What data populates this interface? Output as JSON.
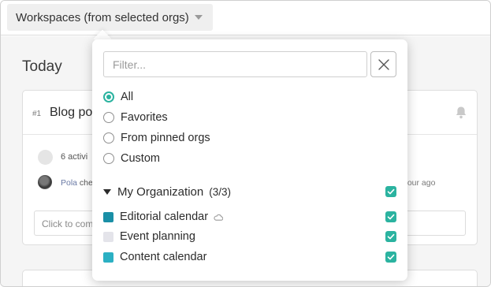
{
  "topbar": {
    "workspace_button_label": "Workspaces (from selected orgs)"
  },
  "main": {
    "section_title": "Today",
    "card": {
      "number": "#1",
      "title": "Blog po",
      "activity": "6 activi",
      "actor": "Pola",
      "action": " che",
      "time_ago": "hour ago",
      "comment_placeholder": "Click to com"
    }
  },
  "dropdown": {
    "filter_placeholder": "Filter...",
    "filter_value": "",
    "options": [
      {
        "label": "All",
        "selected": true
      },
      {
        "label": "Favorites",
        "selected": false
      },
      {
        "label": "From pinned orgs",
        "selected": false
      },
      {
        "label": "Custom",
        "selected": false
      }
    ],
    "organization": {
      "name": "My Organization",
      "count": "(3/3)",
      "checked": true
    },
    "workspaces": [
      {
        "label": "Editorial calendar",
        "color": "#1a8fa6",
        "cloud_icon": "cloud-icon",
        "checked": true
      },
      {
        "label": "Event planning",
        "color": "#e4e4ea",
        "checked": true
      },
      {
        "label": "Content calendar",
        "color": "#2bb0c3",
        "checked": true
      }
    ]
  },
  "colors": {
    "accent": "#2bb3a0"
  }
}
